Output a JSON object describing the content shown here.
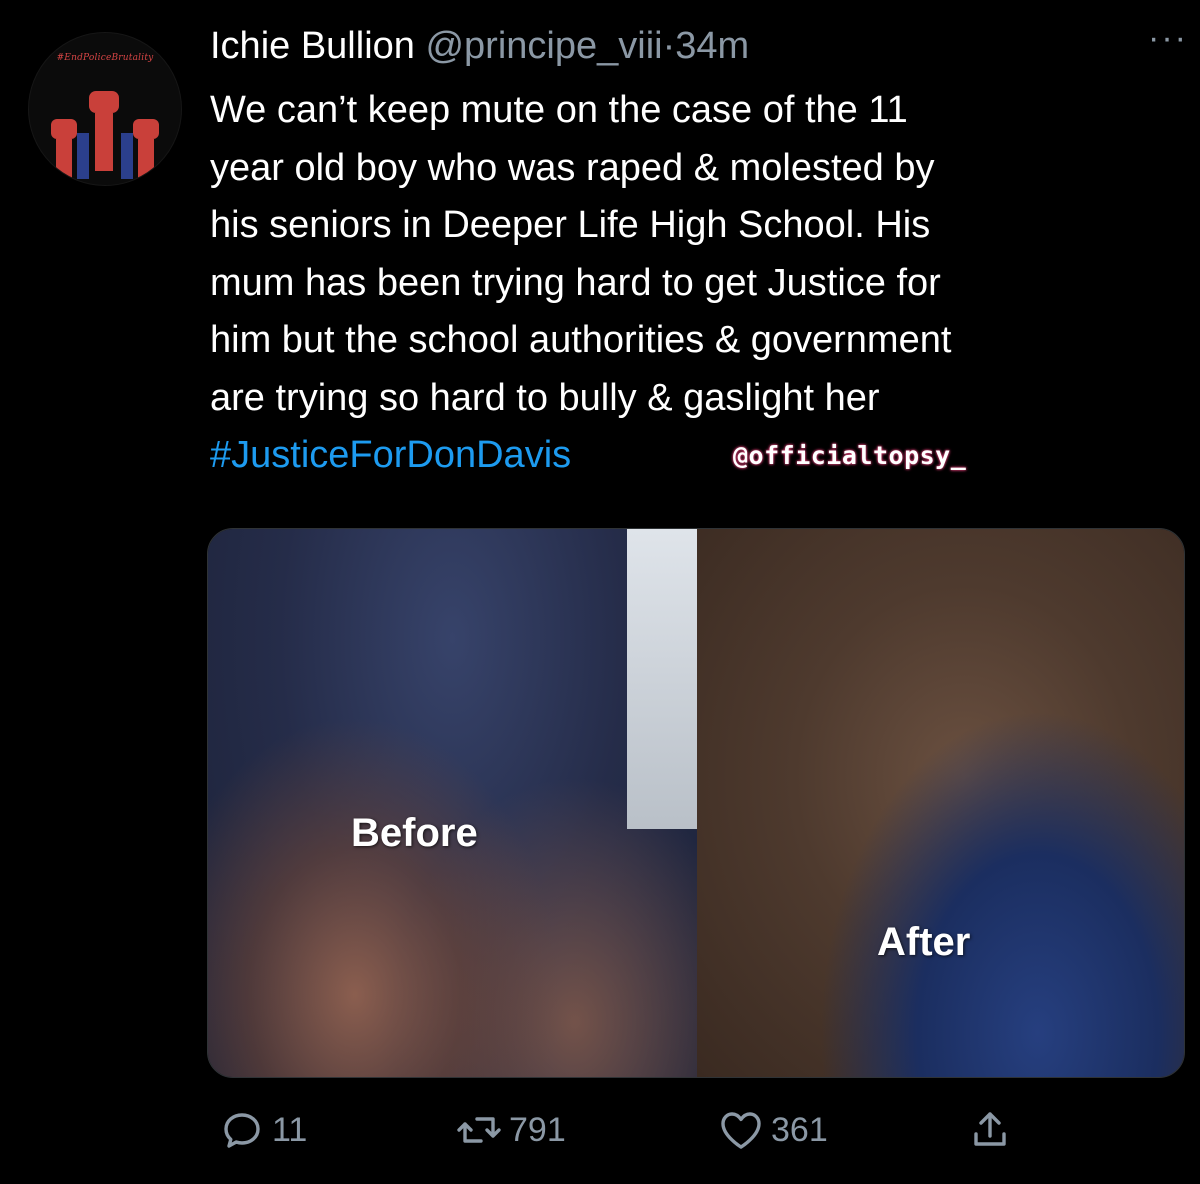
{
  "avatar": {
    "caption": "#EndPoliceBrutality",
    "icon": "raised-fists-icon",
    "colors": {
      "fist": "#c9403a",
      "background": "#0b0b0b"
    }
  },
  "tweet": {
    "author_name": "Ichie Bullion",
    "handle": "@principe_viii",
    "separator": "·",
    "time": "34m",
    "more_icon": "···",
    "text_lines": [
      "We can’t keep mute on the case of the 11",
      "year old boy who was raped & molested by",
      "his seniors in Deeper Life High School. His",
      "mum has been trying hard to get Justice for",
      "him but the school authorities & government",
      "are trying so hard to bully & gaslight her"
    ],
    "hashtag": "#JusticeForDonDavis",
    "watermark": "@officialtopsy_",
    "colors": {
      "text": "#ffffff",
      "secondary": "#8b98a5",
      "link": "#1d9bf0"
    }
  },
  "media": {
    "images": [
      {
        "label": "Before"
      },
      {
        "label": "After"
      }
    ]
  },
  "actions": {
    "reply": {
      "icon": "reply-icon",
      "count": "11"
    },
    "retweet": {
      "icon": "retweet-icon",
      "count": "791"
    },
    "like": {
      "icon": "heart-icon",
      "count": "361"
    },
    "share": {
      "icon": "share-icon"
    }
  }
}
